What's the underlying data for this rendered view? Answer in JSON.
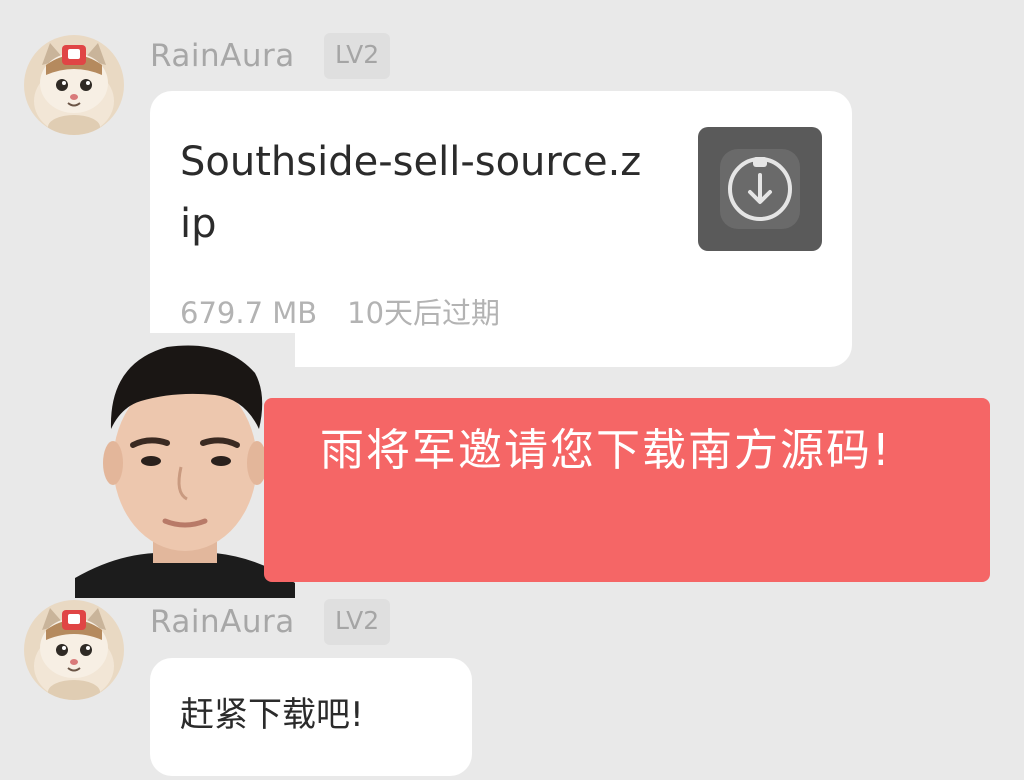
{
  "messages": [
    {
      "sender": "RainAura",
      "level": "LV2",
      "avatar_icon": "cat-avatar-icon",
      "file": {
        "name": "Southside-sell-source.zip",
        "size": "679.7 MB",
        "expiry": "10天后过期",
        "icon": "download-icon"
      }
    },
    {
      "sender": "RainAura",
      "level": "LV2",
      "avatar_icon": "cat-avatar-icon",
      "text": "赶紧下载吧!"
    }
  ],
  "overlay": {
    "photo": "person-photo",
    "banner_text": "雨将军邀请您下载南方源码!",
    "banner_color": "#f56666"
  },
  "colors": {
    "background": "#e9e9e9",
    "bubble": "#ffffff",
    "username": "#a7a7a7",
    "file_icon_bg": "#5a5a5a"
  }
}
